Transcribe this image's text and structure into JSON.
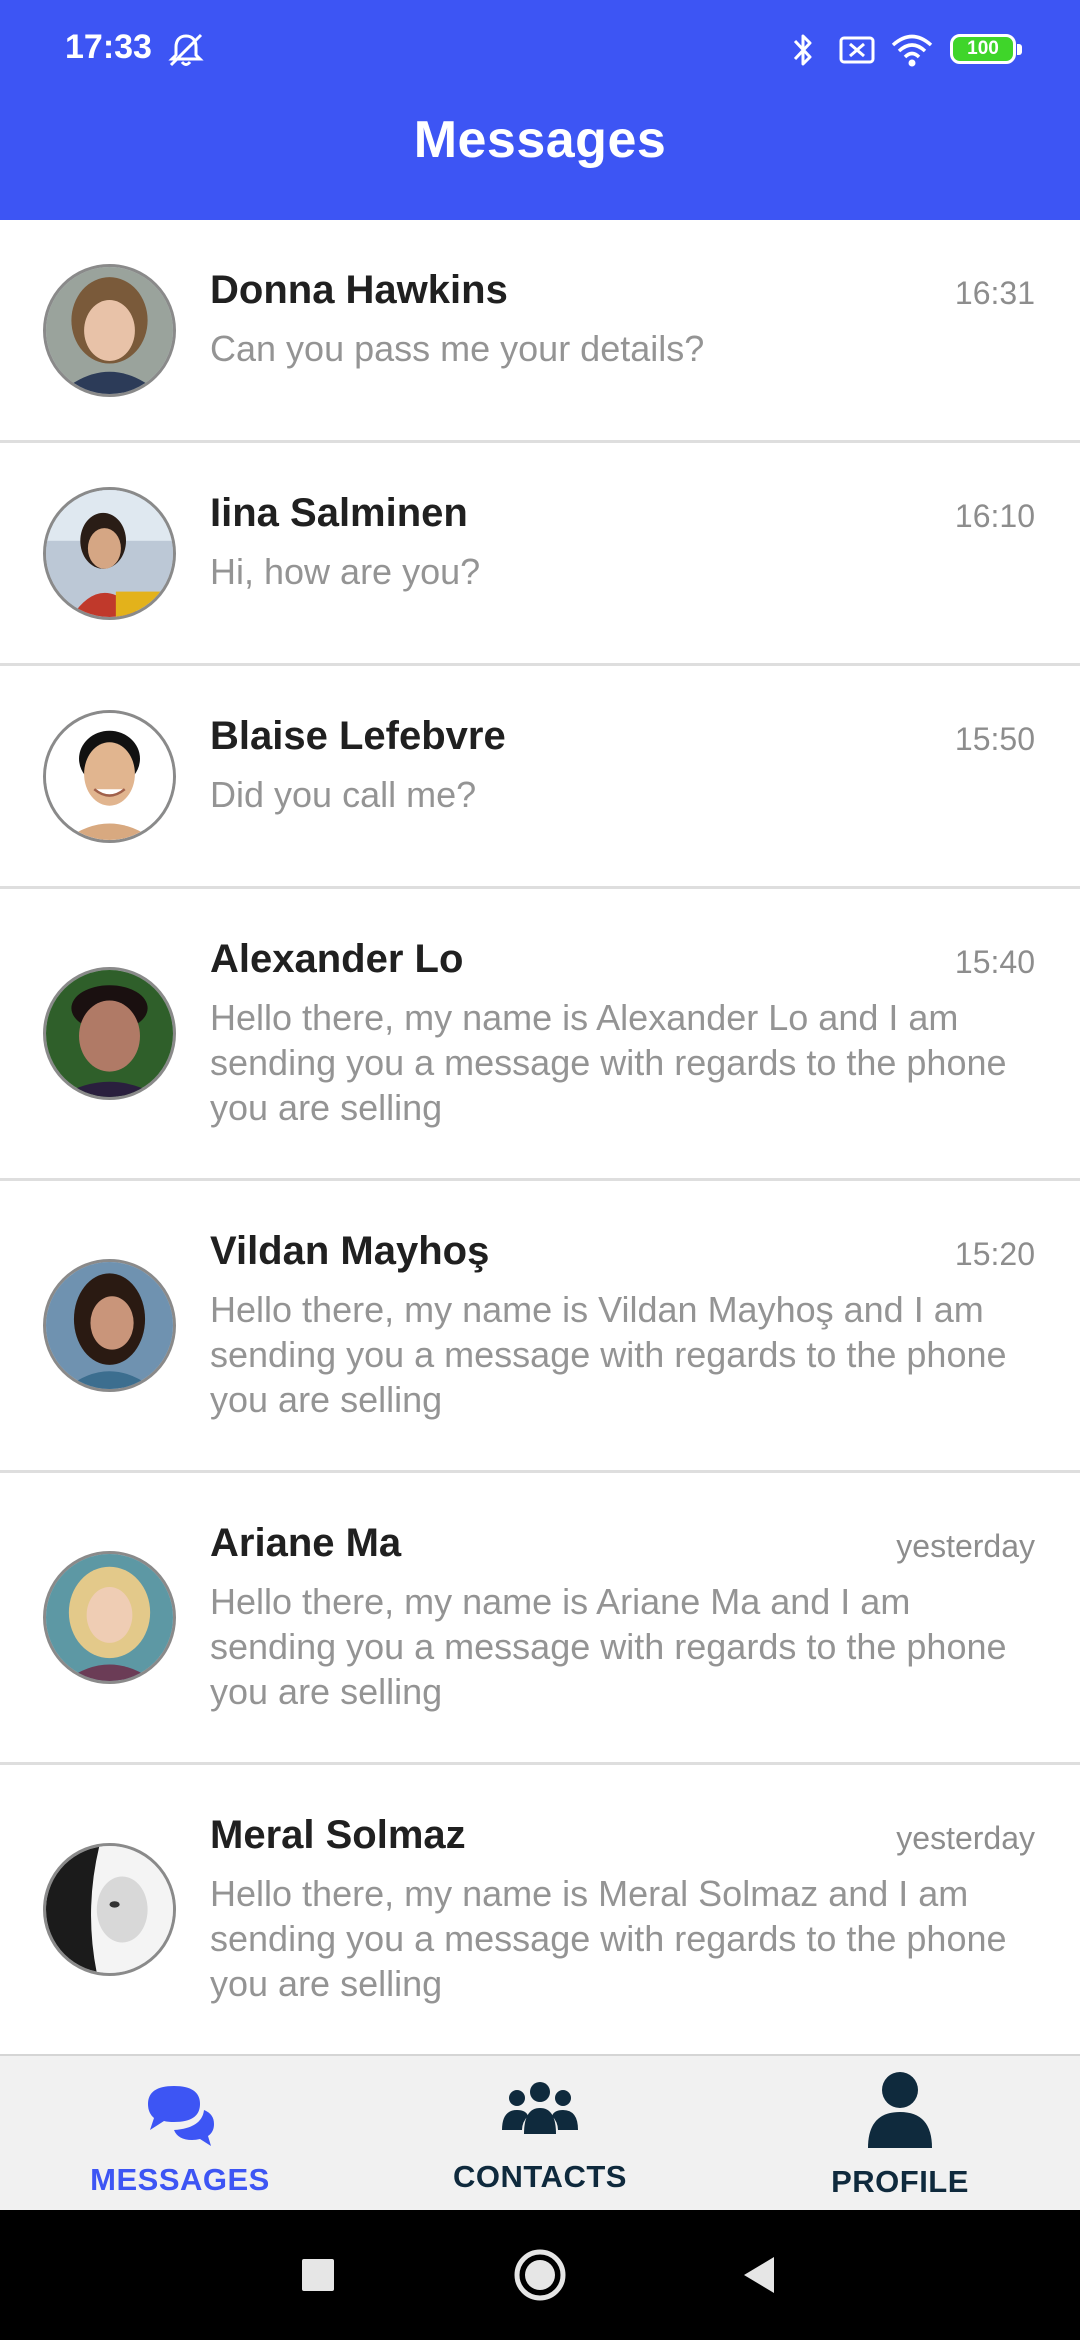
{
  "status_bar": {
    "time": "17:33",
    "battery": "100",
    "icons": [
      "mute-icon",
      "bluetooth-icon",
      "sim-icon",
      "wifi-icon",
      "battery-icon"
    ]
  },
  "header": {
    "title": "Messages"
  },
  "messages": [
    {
      "name": "Donna Hawkins",
      "time": "16:31",
      "text": "Can you pass me your details?"
    },
    {
      "name": "Iina Salminen",
      "time": "16:10",
      "text": "Hi, how are you?"
    },
    {
      "name": "Blaise Lefebvre",
      "time": "15:50",
      "text": "Did you call me?"
    },
    {
      "name": "Alexander Lo",
      "time": "15:40",
      "text": "Hello there, my name is Alexander Lo and I am sending you a message with regards to the phone you are selling"
    },
    {
      "name": "Vildan Mayhoş",
      "time": "15:20",
      "text": "Hello there, my name is Vildan Mayhoş and I am sending you a message with regards to the phone you are selling"
    },
    {
      "name": "Ariane Ma",
      "time": "yesterday",
      "text": "Hello there, my name is Ariane Ma and I am sending you a message with regards to the phone you are selling"
    },
    {
      "name": "Meral Solmaz",
      "time": "yesterday",
      "text": "Hello there, my name is Meral Solmaz and I am sending you a message with regards to the phone you are selling"
    }
  ],
  "bottom_nav": {
    "items": [
      {
        "label": "MESSAGES",
        "icon": "chat-bubbles-icon",
        "active": true
      },
      {
        "label": "CONTACTS",
        "icon": "people-group-icon",
        "active": false
      },
      {
        "label": "PROFILE",
        "icon": "person-icon",
        "active": false
      }
    ]
  },
  "system_nav": {
    "icons": [
      "recents-icon",
      "home-icon",
      "back-icon"
    ]
  },
  "colors": {
    "header": "#3d55f4",
    "active_nav": "#3d55f4",
    "inactive_nav": "#0f2a3d",
    "name_text": "#202020",
    "secondary_text": "#949494"
  }
}
